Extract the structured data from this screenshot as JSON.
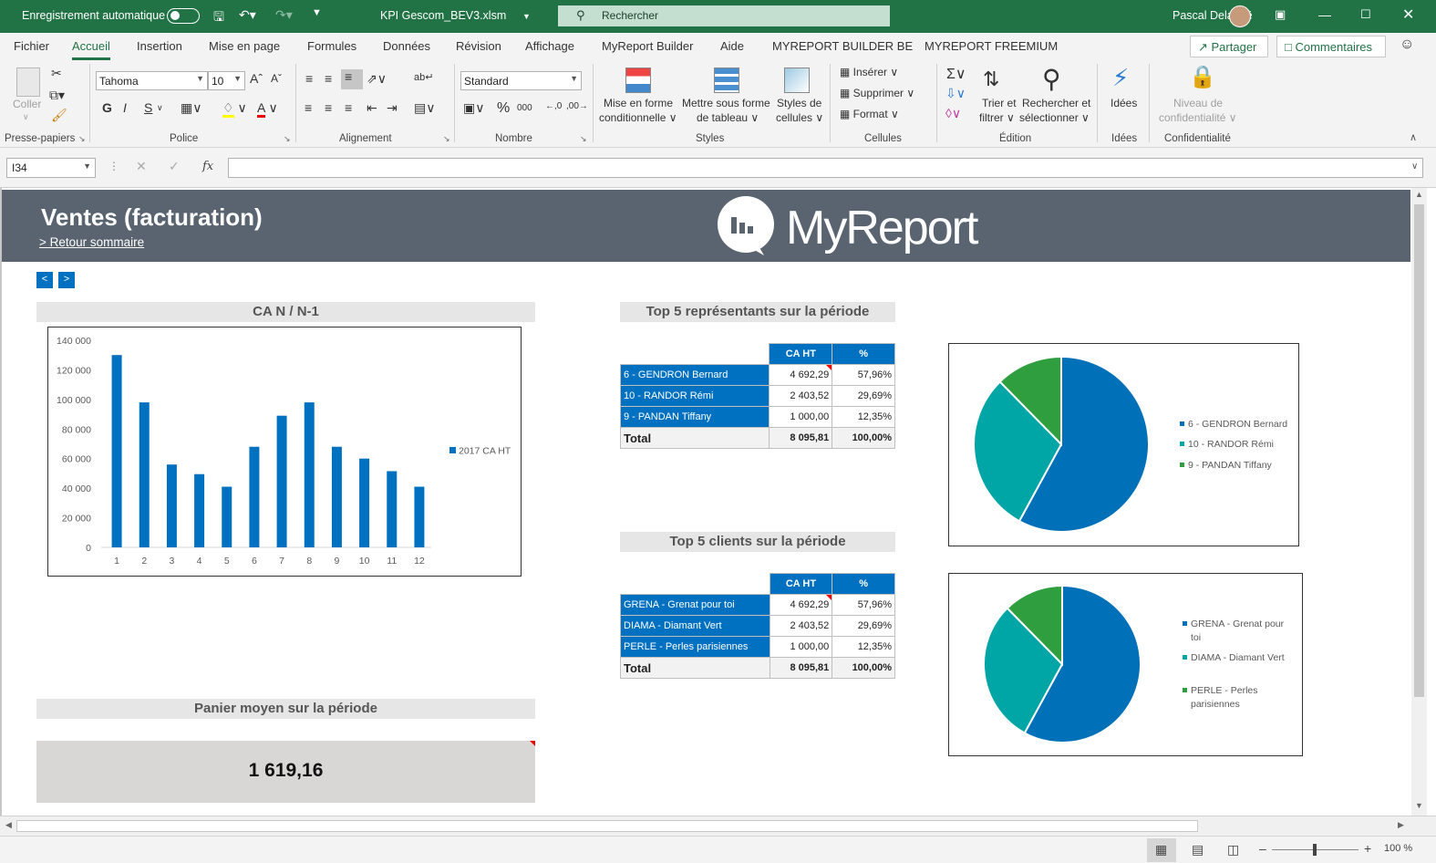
{
  "titlebar": {
    "autosave_label": "Enregistrement automatique",
    "filename": "KPI Gescom_BEV3.xlsm",
    "search_placeholder": "Rechercher",
    "user_name": "Pascal Delanoë"
  },
  "menu": {
    "tabs": [
      "Fichier",
      "Accueil",
      "Insertion",
      "Mise en page",
      "Formules",
      "Données",
      "Révision",
      "Affichage",
      "MyReport Builder",
      "Aide",
      "MYREPORT BUILDER BE",
      "MYREPORT FREEMIUM"
    ],
    "active": "Accueil",
    "share_label": "Partager",
    "comments_label": "Commentaires"
  },
  "ribbon": {
    "paste_label": "Coller",
    "font_name": "Tahoma",
    "font_size": "10",
    "bold": "G",
    "italic": "I",
    "underline": "S",
    "number_format": "Standard",
    "cond_format_l1": "Mise en forme",
    "cond_format_l2": "conditionnelle",
    "format_table_l1": "Mettre sous forme",
    "format_table_l2": "de tableau",
    "cell_styles_l1": "Styles de",
    "cell_styles_l2": "cellules",
    "insert_label": "Insérer",
    "delete_label": "Supprimer",
    "format_label": "Format",
    "sort_l1": "Trier et",
    "sort_l2": "filtrer",
    "find_l1": "Rechercher et",
    "find_l2": "sélectionner",
    "ideas_label": "Idées",
    "sensitivity_l1": "Niveau de",
    "sensitivity_l2": "confidentialité",
    "groups": [
      "Presse-papiers",
      "Police",
      "Alignement",
      "Nombre",
      "Styles",
      "Cellules",
      "Édition",
      "Idées",
      "Confidentialité"
    ]
  },
  "formula_bar": {
    "cell_ref": "I34",
    "fx": "fx",
    "content": ""
  },
  "dashboard": {
    "title": "Ventes (facturation)",
    "back_link": "> Retour sommaire",
    "logo_text": "MyReport",
    "nav_prev": "<",
    "nav_next": ">",
    "chart_section_title": "CA N / N-1",
    "reps_section_title": "Top 5 représentants sur la période",
    "clients_section_title": "Top 5 clients sur la période",
    "basket_section_title": "Panier moyen sur la période",
    "basket_value": "1 619,16",
    "col_ca": "CA HT",
    "col_pct": "%",
    "total_label": "Total"
  },
  "reps_table": {
    "rows": [
      {
        "name": "6 - GENDRON Bernard",
        "ca": "4 692,29",
        "pct": "57,96%"
      },
      {
        "name": "10 - RANDOR Rémi",
        "ca": "2 403,52",
        "pct": "29,69%"
      },
      {
        "name": "9 - PANDAN Tiffany",
        "ca": "1 000,00",
        "pct": "12,35%"
      }
    ],
    "total_ca": "8 095,81",
    "total_pct": "100,00%"
  },
  "clients_table": {
    "rows": [
      {
        "name": "GRENA - Grenat pour toi",
        "ca": "4 692,29",
        "pct": "57,96%"
      },
      {
        "name": "DIAMA - Diamant Vert",
        "ca": "2 403,52",
        "pct": "29,69%"
      },
      {
        "name": "PERLE - Perles parisiennes",
        "ca": "1 000,00",
        "pct": "12,35%"
      }
    ],
    "total_ca": "8 095,81",
    "total_pct": "100,00%"
  },
  "colors": {
    "excel_green": "#217346",
    "banner": "#5a6470",
    "bar_blue": "#0070c0",
    "pie_blue": "#0070b8",
    "pie_teal": "#00a6a6",
    "pie_green": "#2e9e3e"
  },
  "chart_data": [
    {
      "type": "bar",
      "categories": [
        "1",
        "2",
        "3",
        "4",
        "5",
        "6",
        "7",
        "8",
        "9",
        "10",
        "11",
        "12"
      ],
      "series": [
        {
          "name": "2017 CA HT",
          "values": [
            130000,
            98000,
            56000,
            49500,
            41000,
            68000,
            89000,
            98000,
            68000,
            60000,
            51500,
            41000
          ]
        }
      ],
      "ylim": [
        0,
        140000
      ],
      "yticks": [
        "0",
        "20 000",
        "40 000",
        "60 000",
        "80 000",
        "100 000",
        "120 000",
        "140 000"
      ],
      "legend": "right",
      "title": "",
      "xlabel": "",
      "ylabel": ""
    },
    {
      "type": "pie",
      "labels": [
        "6 - GENDRON Bernard",
        "10 - RANDOR Rémi",
        "9 - PANDAN Tiffany"
      ],
      "values": [
        57.96,
        29.69,
        12.35
      ],
      "legend": "right"
    },
    {
      "type": "pie",
      "labels": [
        "GRENA - Grenat pour toi",
        "DIAMA - Diamant Vert",
        "PERLE - Perles parisiennes"
      ],
      "values": [
        57.96,
        29.69,
        12.35
      ],
      "legend": "right"
    }
  ],
  "statusbar": {
    "zoom": "100 %"
  }
}
